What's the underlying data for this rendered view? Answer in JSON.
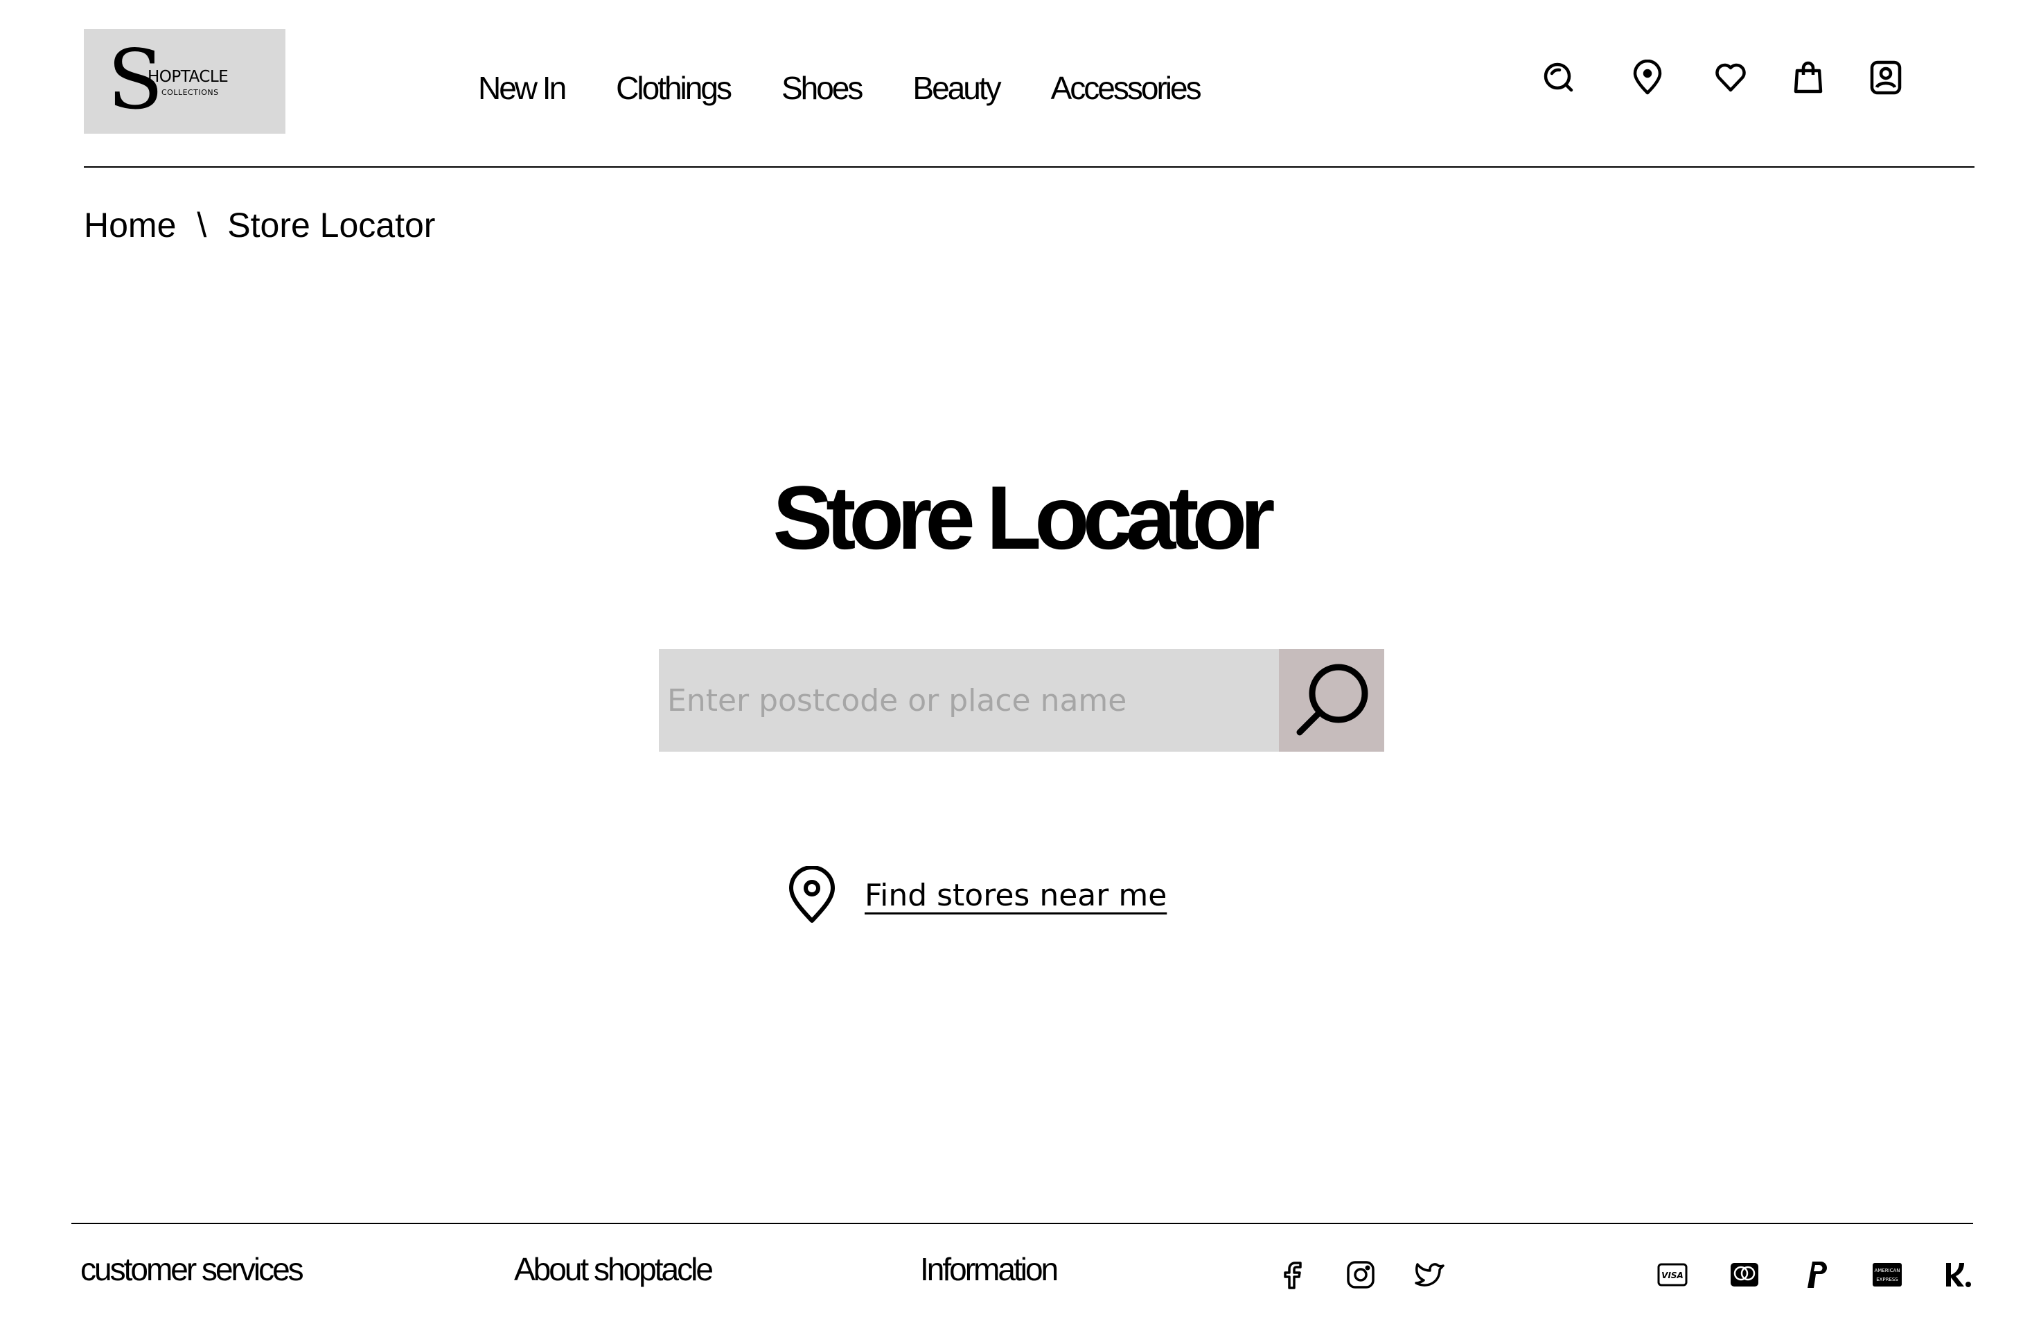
{
  "brand": {
    "initial": "S",
    "name": "HOPTACLE",
    "tagline": "COLLECTIONS"
  },
  "nav": {
    "items": [
      "New In",
      "Clothings",
      "Shoes",
      "Beauty",
      "Accessories"
    ]
  },
  "header_icons": [
    "search-icon",
    "location-pin-icon",
    "heart-icon",
    "shopping-bag-icon",
    "account-icon"
  ],
  "breadcrumb": {
    "home": "Home",
    "separator": "\\",
    "current": "Store Locator"
  },
  "main": {
    "title": "Store Locator",
    "search_placeholder": "Enter postcode or place name",
    "search_value": "",
    "near_me_label": "Find stores near me"
  },
  "colors": {
    "logo_bg": "#d9d9d9",
    "input_bg": "#d9d9d9",
    "search_button_bg": "#c6bcbc",
    "placeholder": "#a6a6a6"
  },
  "footer": {
    "links": [
      "customer services",
      "About shoptacle",
      "Information"
    ],
    "social_icons": [
      "facebook-icon",
      "instagram-icon",
      "twitter-icon"
    ],
    "payment_icons": [
      "visa-icon",
      "mastercard-icon",
      "paypal-icon",
      "amex-icon",
      "klarna-icon"
    ]
  }
}
